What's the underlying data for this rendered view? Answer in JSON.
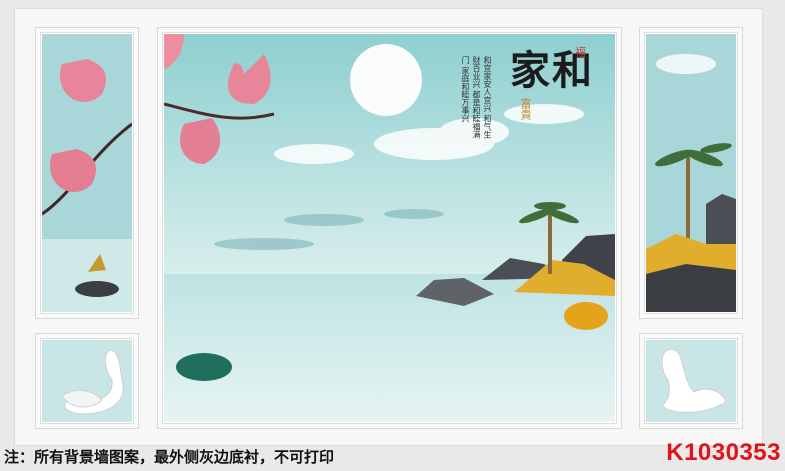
{
  "artwork": {
    "calligraphy_main": "家和",
    "seal_small": "福",
    "gold_text": "富貴",
    "poem_lines": "和宜家安人宜兴 和气生财百业兴 都是和睦福满门 家庭和睦万事兴"
  },
  "footer": {
    "note": "注：所有背景墙图案，最外侧灰边底衬，不可打印",
    "product_code": "K1030353"
  },
  "colors": {
    "sky": "#a8d6d8",
    "water": "#c9e6e6",
    "code_red": "#e0131b",
    "flower_pink": "#e7869a"
  }
}
